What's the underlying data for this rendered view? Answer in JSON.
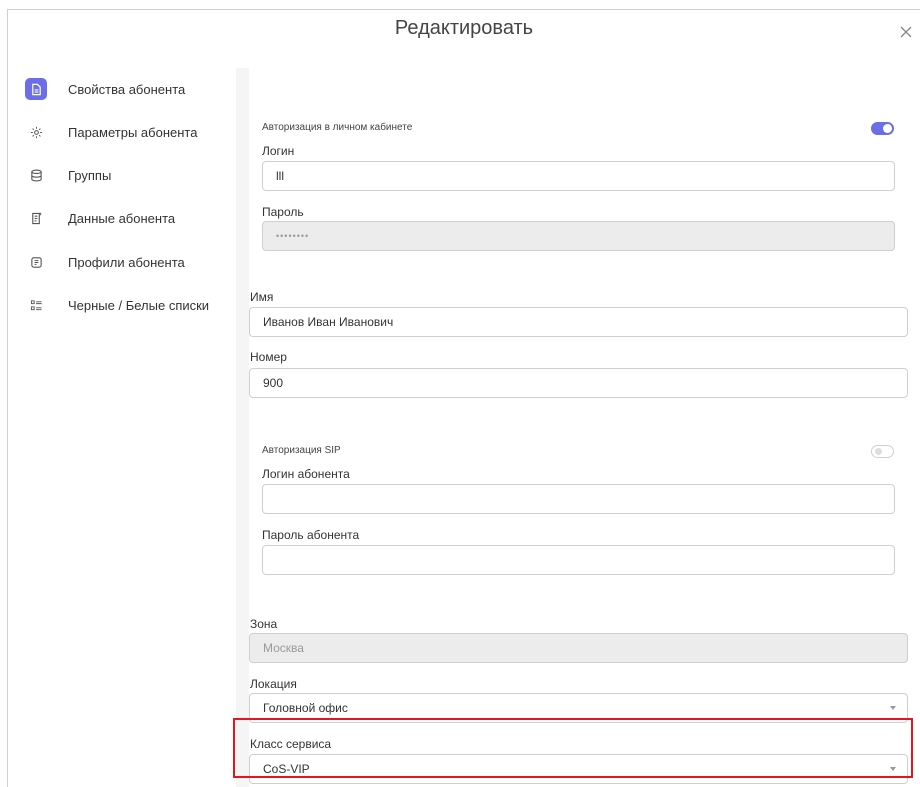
{
  "modal": {
    "title": "Редактировать"
  },
  "sidebar": {
    "items": [
      {
        "label": "Свойства абонента",
        "icon": "document-icon",
        "active": true
      },
      {
        "label": "Параметры абонента",
        "icon": "settings-dots-icon",
        "active": false
      },
      {
        "label": "Группы",
        "icon": "database-icon",
        "active": false
      },
      {
        "label": "Данные абонента",
        "icon": "data-sheet-icon",
        "active": false
      },
      {
        "label": "Профили абонента",
        "icon": "profile-card-icon",
        "active": false
      },
      {
        "label": "Черные / Белые списки",
        "icon": "list-icon",
        "active": false
      }
    ]
  },
  "cabinet_auth": {
    "title": "Авторизация в личном кабинете",
    "enabled": true,
    "login_label": "Логин",
    "login_value": "lll",
    "password_label": "Пароль",
    "password_value": "••••••••"
  },
  "name": {
    "label": "Имя",
    "value": "Иванов Иван Иванович"
  },
  "number": {
    "label": "Номер",
    "value": "900"
  },
  "sip_auth": {
    "title": "Авторизация SIP",
    "enabled": false,
    "login_label": "Логин абонента",
    "login_value": "",
    "password_label": "Пароль абонента",
    "password_value": ""
  },
  "zone": {
    "label": "Зона",
    "value": "Москва"
  },
  "location": {
    "label": "Локация",
    "value": "Головной офис"
  },
  "service_class": {
    "label": "Класс сервиса",
    "value": "CoS-VIP"
  },
  "colors": {
    "accent": "#6c6ee8",
    "highlight": "#e8141c"
  }
}
